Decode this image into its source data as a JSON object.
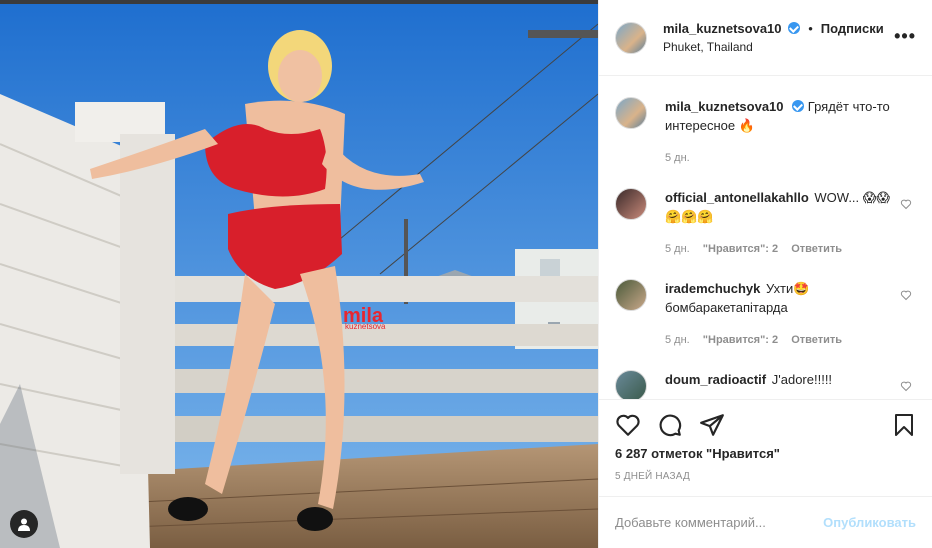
{
  "post": {
    "username": "mila_kuznetsova10",
    "dot": "•",
    "follow_label": "Подписки",
    "location": "Phuket, Thailand",
    "more_label": "•••",
    "watermark": "mila",
    "watermark_sub": "kuznetsova"
  },
  "caption": {
    "username": "mila_kuznetsova10",
    "text": "Грядёт что-то интересное 🔥",
    "time": "5 дн."
  },
  "comments": [
    {
      "username": "official_antonellakahllo",
      "text": "WOW... 😱😱🤗🤗🤗",
      "time": "5 дн.",
      "likes": "\"Нравится\": 2",
      "reply": "Ответить"
    },
    {
      "username": "irademchuchyk",
      "text": "Ухти🤩 бомбаракетапітарда",
      "time": "5 дн.",
      "likes": "\"Нравится\": 2",
      "reply": "Ответить"
    },
    {
      "username": "doum_radioactif",
      "text": "J'adore!!!!!"
    }
  ],
  "stats": {
    "likes": "6 287 отметок \"Нравится\"",
    "date": "5 дней назад"
  },
  "comment_box": {
    "placeholder": "Добавьте комментарий...",
    "publish_label": "Опубликовать"
  },
  "icons": [
    "heart-icon",
    "comment-icon",
    "share-icon",
    "bookmark-icon",
    "more-icon",
    "user-tag-icon",
    "verified-icon"
  ]
}
